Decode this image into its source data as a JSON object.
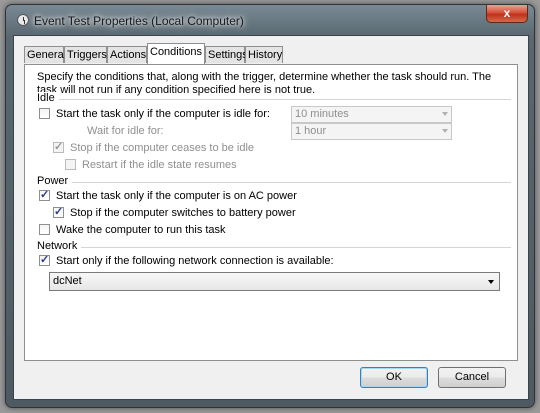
{
  "window": {
    "title": "Event Test Properties (Local Computer)",
    "close_label": "x"
  },
  "tabs": [
    {
      "label": "General"
    },
    {
      "label": "Triggers"
    },
    {
      "label": "Actions"
    },
    {
      "label": "Conditions",
      "active": true
    },
    {
      "label": "Settings"
    },
    {
      "label": "History"
    }
  ],
  "conditions": {
    "description": "Specify the conditions that, along with the trigger, determine whether the task should run.  The task will not run  if any condition specified here is not true.",
    "idle": {
      "header": "Idle",
      "start_if_idle": {
        "label": "Start the task only if the computer is idle for:",
        "checked": false
      },
      "idle_duration": {
        "value": "10 minutes"
      },
      "wait_label": "Wait for idle for:",
      "wait_duration": {
        "value": "1 hour"
      },
      "stop_if_not_idle": {
        "label": "Stop if the computer ceases to be idle",
        "checked": true
      },
      "restart_if_idle": {
        "label": "Restart if the idle state resumes",
        "checked": false
      }
    },
    "power": {
      "header": "Power",
      "ac_power": {
        "label": "Start the task only if the computer is on AC power",
        "checked": true
      },
      "battery_stop": {
        "label": "Stop if the computer switches to battery power",
        "checked": true
      },
      "wake": {
        "label": "Wake the computer to run this task",
        "checked": false
      }
    },
    "network": {
      "header": "Network",
      "start_if_network": {
        "label": "Start only if the following network connection is available:",
        "checked": true
      },
      "connection": {
        "value": "dcNet"
      }
    }
  },
  "buttons": {
    "ok": "OK",
    "cancel": "Cancel"
  }
}
